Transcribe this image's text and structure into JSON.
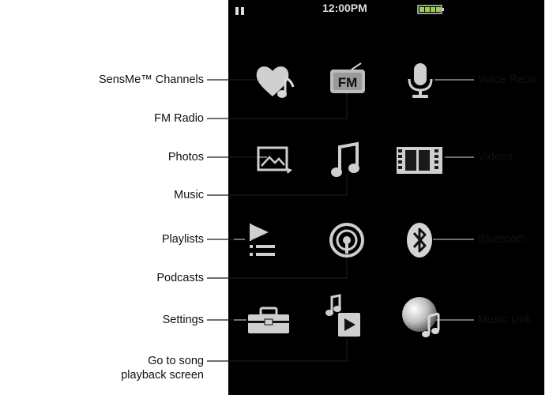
{
  "status_bar": {
    "time": "12:00PM",
    "play_state": "pause-icon",
    "battery": "battery-full-icon"
  },
  "left_labels": {
    "sensme": "SensMe™ Channels",
    "fm": "FM Radio",
    "photos": "Photos",
    "music": "Music",
    "playlists": "Playlists",
    "podcasts": "Podcasts",
    "settings": "Settings",
    "goto_1": "Go to song",
    "goto_2": "playback screen"
  },
  "right_labels": {
    "voice": "Voice Reco",
    "videos": "Videos",
    "bluetooth": "Bluetooth",
    "music_unli": "Music Unli"
  },
  "icons": {
    "fm_text": "FM",
    "names": [
      "heart-music-icon",
      "fm-radio-icon",
      "microphone-icon",
      "photos-icon",
      "music-note-icon",
      "film-strip-icon",
      "playlist-icon",
      "podcast-icon",
      "bluetooth-icon",
      "toolbox-icon",
      "now-playing-icon",
      "music-unlimited-icon"
    ]
  },
  "colors": {
    "screen": "#000000",
    "icon_gray": "#c8c8c8",
    "leader_line": "#b0b0b0"
  }
}
